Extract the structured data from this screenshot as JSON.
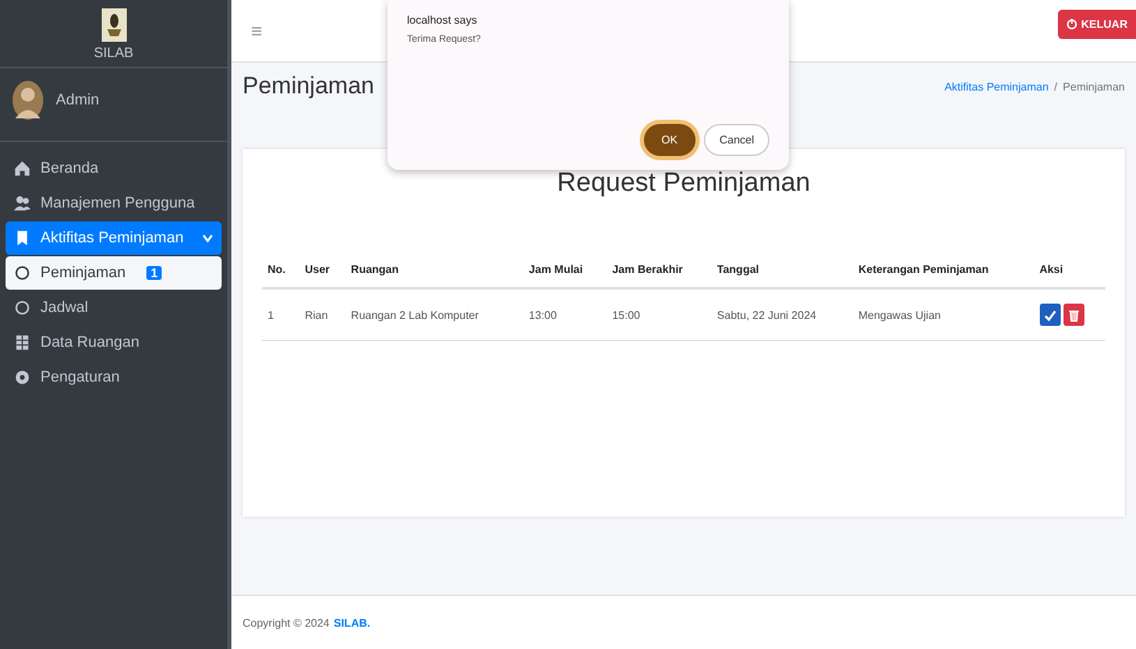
{
  "sidebar": {
    "brand": "SILAB",
    "user": "Admin",
    "items": [
      {
        "label": "Beranda",
        "selected": false
      },
      {
        "label": "Manajemen Pengguna",
        "selected": false
      },
      {
        "label": "Aktifitas Peminjaman",
        "selected": true,
        "expanded": true,
        "children": [
          {
            "label": "Peminjaman",
            "selected": true,
            "badge": "1"
          },
          {
            "label": "Jadwal",
            "selected": false
          }
        ]
      },
      {
        "label": "Data Ruangan",
        "selected": false
      },
      {
        "label": "Pengaturan",
        "selected": false
      }
    ]
  },
  "topbar": {
    "menu_glyph": "≡",
    "logout": "KELUAR"
  },
  "page": {
    "title": "Peminjaman",
    "breadcrumb_separator": "/",
    "breadcrumb": [
      {
        "label": "Aktifitas Peminjaman",
        "link": true
      },
      {
        "label": "Peminjaman",
        "link": false
      }
    ]
  },
  "card": {
    "title": "Request Peminjaman",
    "table": {
      "columns": [
        "No.",
        "User",
        "Ruangan",
        "Jam Mulai",
        "Jam Berakhir",
        "Tanggal",
        "Keterangan Peminjaman",
        "Aksi"
      ],
      "rows": [
        [
          "1",
          "Rian",
          "Ruangan 2 Lab Komputer",
          "13:00",
          "15:00",
          "Sabtu, 22 Juni 2024",
          "Mengawas Ujian"
        ]
      ]
    }
  },
  "footer": {
    "text": "Copyright © 2024",
    "brand": "SILAB."
  },
  "dialog": {
    "title": "localhost says",
    "message": "Terima Request?",
    "buttons": [
      {
        "label": "OK",
        "primary": true
      },
      {
        "label": "Cancel",
        "primary": false
      }
    ]
  }
}
